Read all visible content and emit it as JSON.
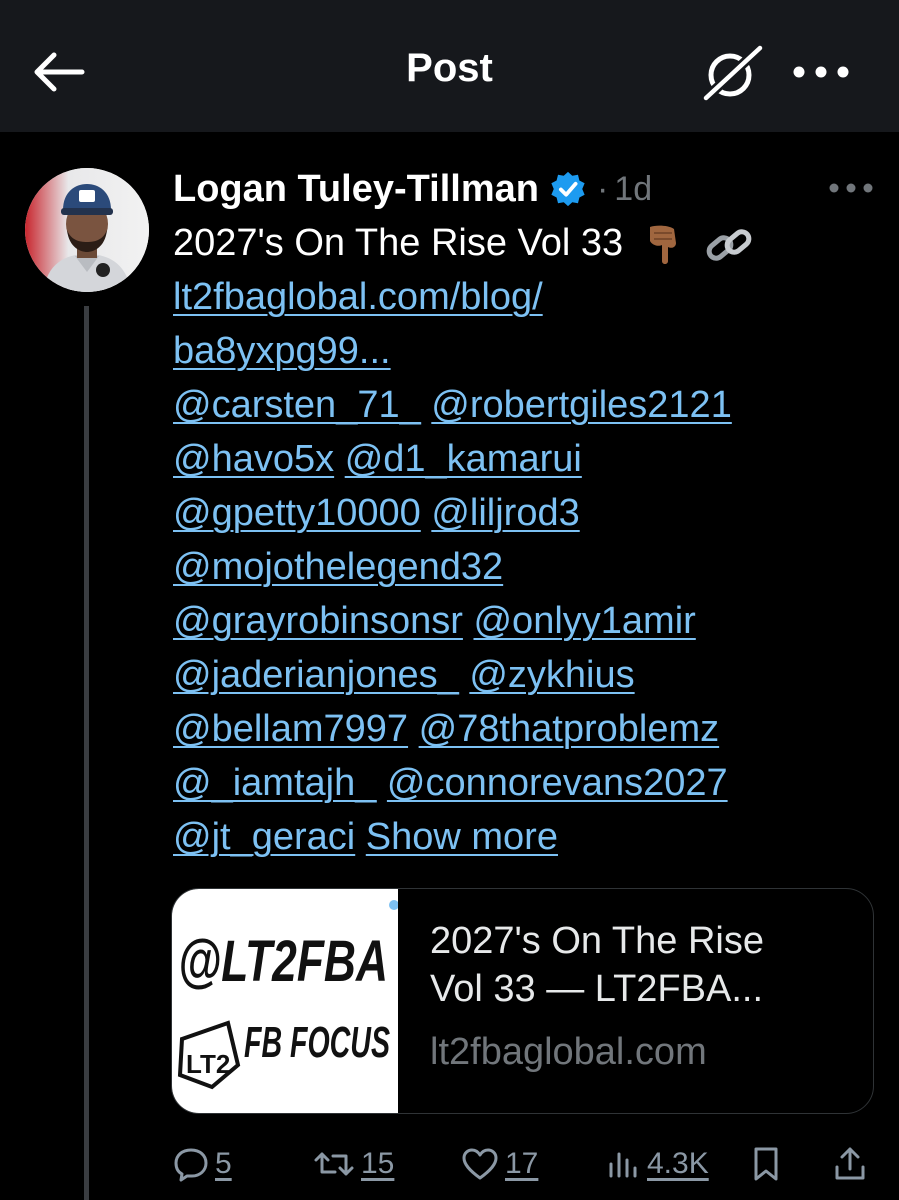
{
  "header": {
    "title": "Post"
  },
  "post": {
    "author_name": "Logan Tuley-Tillman",
    "separator": "·",
    "time": "1d",
    "text_line1": "2027's On The Rise Vol 33",
    "link_line1": "lt2fbaglobal.com/blog/",
    "link_line2": "ba8yxpg99...",
    "mentions": [
      "@carsten_71_",
      "@robertgiles2121",
      "@havo5x",
      "@d1_kamarui",
      "@gpetty10000",
      "@liljrod3",
      "@mojothelegend32",
      "@grayrobinsonsr",
      "@onlyy1amir",
      "@jaderianjones_",
      "@zykhius",
      "@bellam7997",
      "@78thatproblemz",
      "@_iamtajh_",
      "@connorevans2027",
      "@jt_geraci"
    ],
    "show_more": "Show more"
  },
  "card": {
    "title_line1": "2027's On The Rise",
    "title_line2": "Vol 33 — LT2FBA...",
    "domain": "lt2fbaglobal.com",
    "thumb_brand": "@LT2FBA",
    "thumb_sub": "FB FOCUS",
    "thumb_badge": "LT2"
  },
  "actions": {
    "replies": "5",
    "reposts": "15",
    "likes": "17",
    "views": "4.3K"
  },
  "colors": {
    "background": "#000000",
    "header_bg": "#16181c",
    "link": "#7dc1f3",
    "muted": "#71767b",
    "verified": "#1d9bf0"
  }
}
